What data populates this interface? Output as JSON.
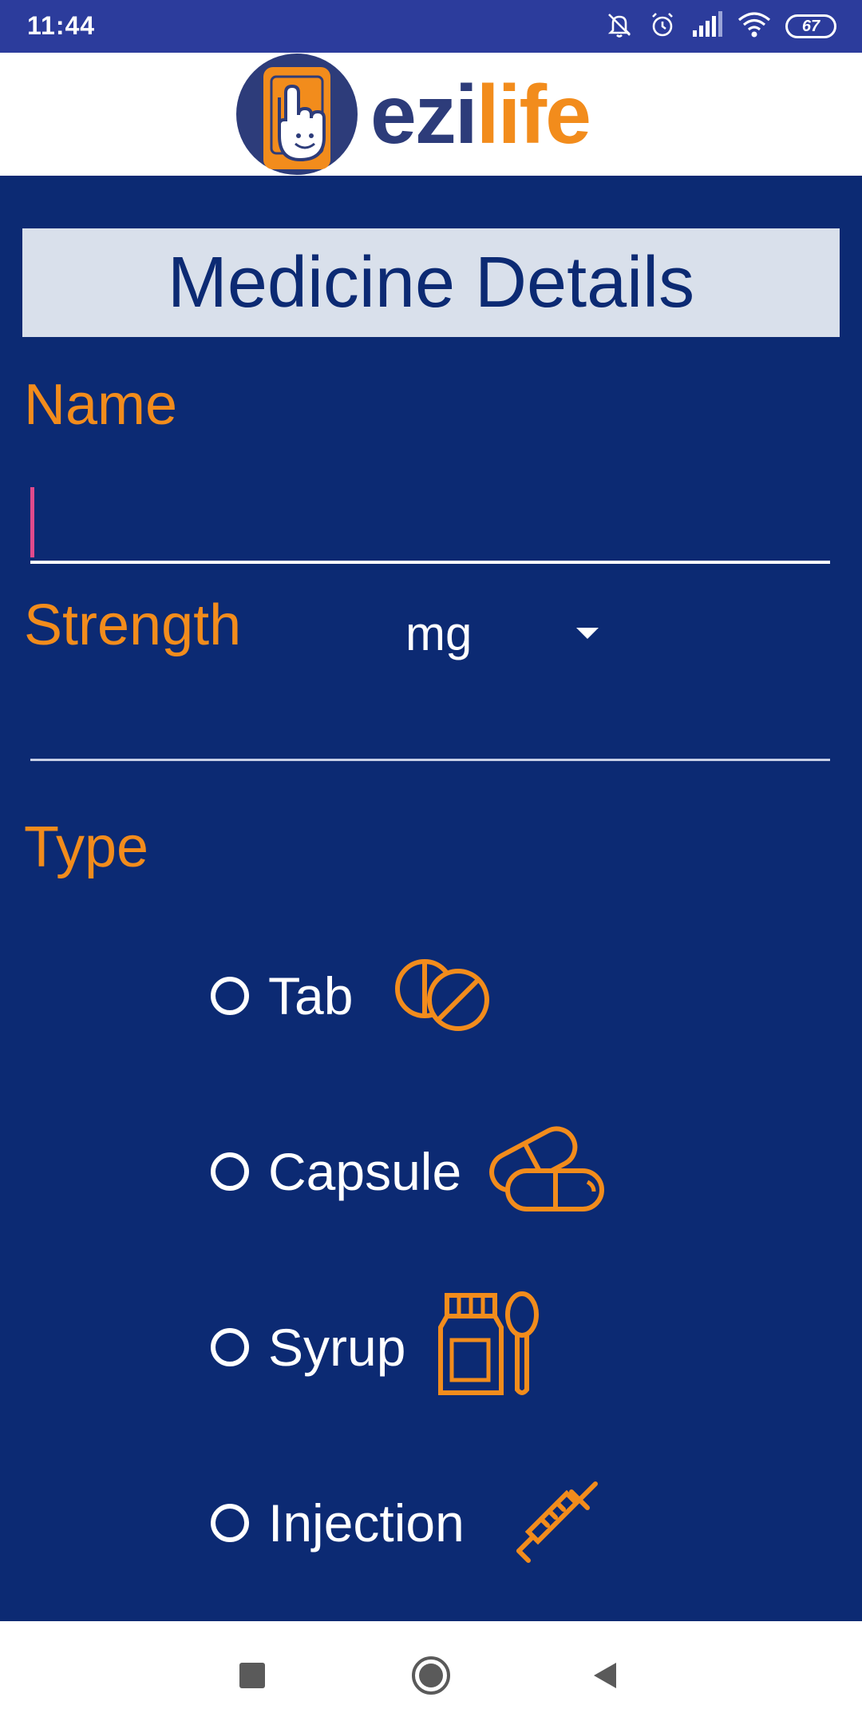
{
  "status_bar": {
    "time": "11:44",
    "battery": "67",
    "icons": [
      "mute-notifications-icon",
      "alarm-icon",
      "signal-icon",
      "wifi-icon",
      "battery-icon"
    ]
  },
  "header": {
    "logo_part1": "ezi",
    "logo_part2": "life"
  },
  "page": {
    "title": "Medicine Details"
  },
  "form": {
    "name_label": "Name",
    "name_value": "",
    "strength_label": "Strength",
    "strength_value": "",
    "unit_selected": "mg",
    "type_label": "Type",
    "types": [
      {
        "label": "Tab",
        "icon": "tablet-icon",
        "selected": false
      },
      {
        "label": "Capsule",
        "icon": "capsule-icon",
        "selected": false
      },
      {
        "label": "Syrup",
        "icon": "syrup-icon",
        "selected": false
      },
      {
        "label": "Injection",
        "icon": "syringe-icon",
        "selected": false
      }
    ]
  },
  "nav_bar": {
    "buttons": [
      "recents-icon",
      "home-icon",
      "back-icon"
    ]
  },
  "colors": {
    "background": "#0c2a73",
    "status_bar": "#2c3c9c",
    "accent": "#f28c1c",
    "title_box": "#d9e0eb",
    "cursor": "#e04a8c"
  }
}
